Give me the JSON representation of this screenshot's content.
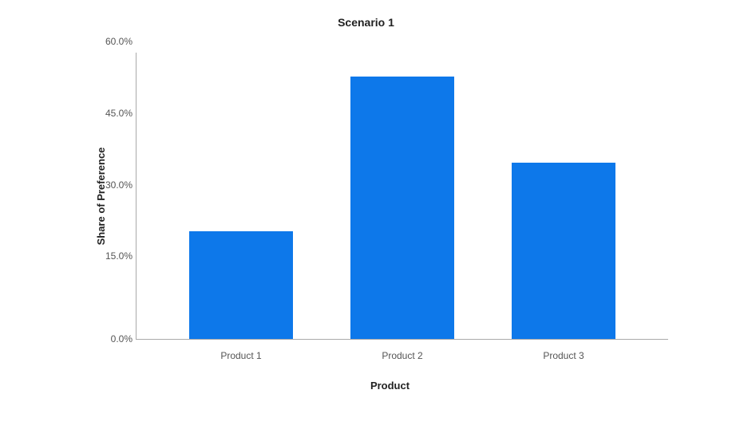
{
  "chart_data": {
    "type": "bar",
    "title": "Scenario 1",
    "xlabel": "Product",
    "ylabel": "Share of Preference",
    "categories": [
      "Product 1",
      "Product 2",
      "Product 3"
    ],
    "values": [
      22.5,
      55.0,
      37.0
    ],
    "ylim": [
      0,
      60
    ],
    "y_ticks": [
      0.0,
      15.0,
      30.0,
      45.0,
      60.0
    ],
    "y_tick_labels": [
      "0.0%",
      "15.0%",
      "30.0%",
      "45.0%",
      "60.0%"
    ],
    "bar_color": "#0d78ea"
  }
}
